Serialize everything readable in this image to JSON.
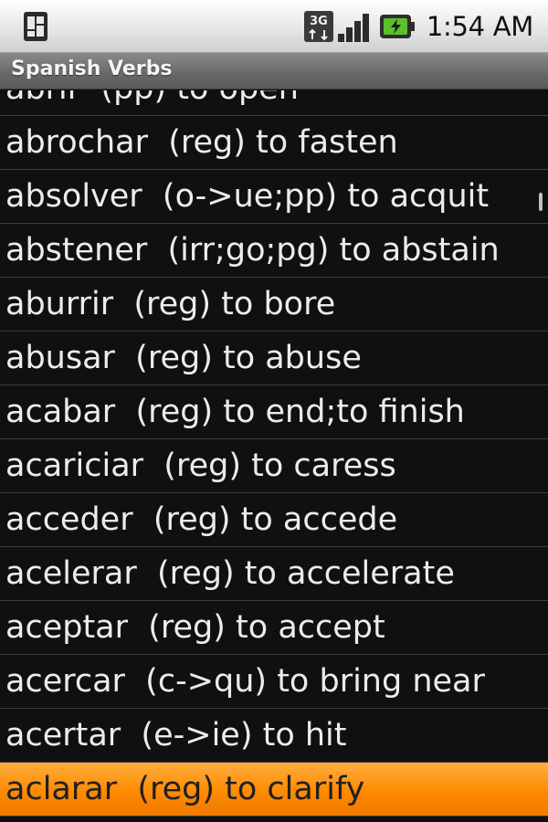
{
  "status_bar": {
    "time": "1:54 AM",
    "network_label": "3G",
    "icons": [
      "sim-notification-icon",
      "network-3g-icon",
      "signal-strength-icon",
      "battery-charging-icon"
    ]
  },
  "app": {
    "title": "Spanish Verbs"
  },
  "verbs": [
    "abrir  (pp) to open",
    "abrochar  (reg) to fasten",
    "absolver  (o->ue;pp) to acquit",
    "abstener  (irr;go;pg) to abstain",
    "aburrir  (reg) to bore",
    "abusar  (reg) to abuse",
    "acabar  (reg) to end;to finish",
    "acariciar  (reg) to caress",
    "acceder  (reg) to accede",
    "acelerar  (reg) to accelerate",
    "aceptar  (reg) to accept",
    "acercar  (c->qu) to bring near",
    "acertar  (e->ie) to hit",
    "aclarar  (reg) to clarify"
  ],
  "selected_index": 13,
  "colors": {
    "selection": "#ff8a00",
    "list_bg": "#101010",
    "divider": "#3c3c3c"
  }
}
